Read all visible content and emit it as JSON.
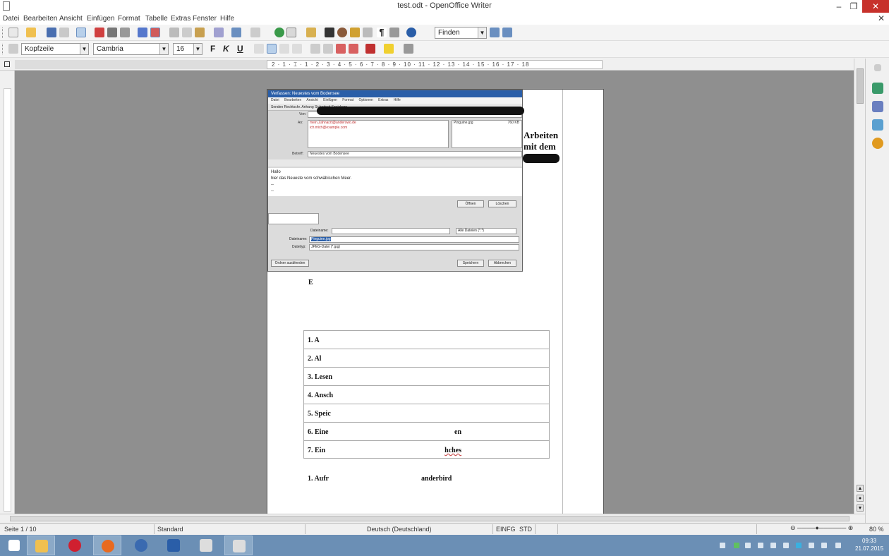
{
  "window": {
    "title": "test.odt - OpenOffice Writer",
    "min_glyph": "–",
    "max_glyph": "❐",
    "close_glyph": "✕",
    "doc_close_glyph": "✕"
  },
  "menu": [
    "Datei",
    "Bearbeiten",
    "Ansicht",
    "Einfügen",
    "Format",
    "Tabelle",
    "Extras",
    "Fenster",
    "Hilfe"
  ],
  "toolbar": {
    "find_placeholder": "Finden",
    "style": "Kopfzeile",
    "font": "Cambria",
    "size": "16",
    "bold": "F",
    "italic": "K",
    "underline": "U"
  },
  "ruler": {
    "labels": "2 · 1 · ⌶ · 1 · 2 · 3 · 4 · 5 · 6 · 7 · 8 · 9 · 10 · 11 · 12 · 13 · 14 · 15 · 16 · 17 · 18"
  },
  "embedded": {
    "title": "Verfassen: Neuestes vom Bodensee",
    "menu": "Datei Bearbeiten Ansicht Einfügen Format Optionen Extras Hilfe",
    "toolbar": "Senden   Rechtschr.   Anhang   Sicherheit   Speichern",
    "from_label": "Von:",
    "to_label": "An:",
    "recipient1": "mein.Zahnarzt@anderswo.de",
    "recipient2": "ich.mich@example.com",
    "attachment": "Pinguine.jpg",
    "attachment_size": "760 KB",
    "subject_label": "Betreff:",
    "subject": "Neuestes vom Bodensee",
    "greeting": "Hallo",
    "body": "hier das Neueste vom schwäbischen Meer.",
    "sig1": "-- ",
    "sig2": "-- ",
    "save_button": "Speichern",
    "cancel_button": "Abbrechen",
    "open_button": "Öffnen",
    "delete_button": "Löschen",
    "filename_label": "Dateiname:",
    "filename": "Pinguine.jpg",
    "filetype_label": "Dateityp:",
    "filetype": "JPEG-Datei (*.jpg)",
    "all_files": "Alle Dateien (*.*)",
    "folder_toggle": "Ordner ausblenden",
    "dir_label": "Dateiname:"
  },
  "document": {
    "heading_line1": "Arbeiten",
    "heading_line2": "mit dem",
    "toc": [
      {
        "text": "1. A",
        "tail": ""
      },
      {
        "text": "2. Al",
        "tail": ""
      },
      {
        "text": "3. Lesen",
        "tail": ""
      },
      {
        "text": "4. Ansch",
        "tail": ""
      },
      {
        "text": "5. Speic",
        "tail": ""
      },
      {
        "text": "6. Eine",
        "tail": "en"
      },
      {
        "text": "7. Ein",
        "tail": "hches"
      }
    ],
    "para1": "1. Aufr",
    "para1_tail": "anderbird",
    "fragment": "E"
  },
  "status": {
    "page": "Seite 1 / 10",
    "style": "Standard",
    "language": "Deutsch (Deutschland)",
    "mode1": "EINFG",
    "mode2": "STD",
    "zoom": "80 %"
  },
  "clock": {
    "time": "09:33",
    "date": "21.07.2015"
  },
  "colors": {
    "taskbar": "#6b8fb5",
    "close": "#c7312b",
    "workspace": "#8f8f8f"
  }
}
